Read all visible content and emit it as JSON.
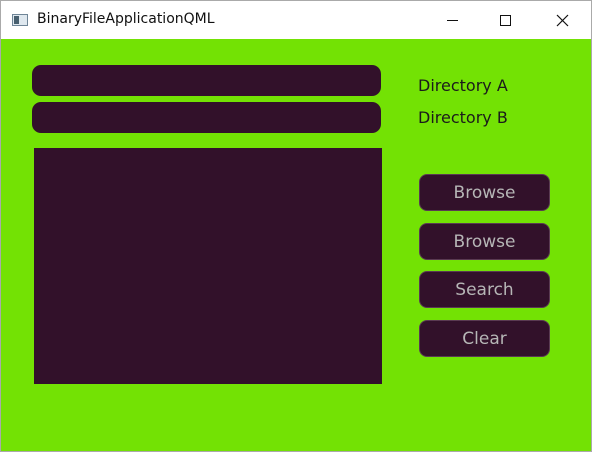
{
  "window": {
    "title": "BinaryFileApplicationQML",
    "icon": "app-window-icon",
    "controls": {
      "minimize_icon": "minimize-icon",
      "maximize_icon": "maximize-icon",
      "close_icon": "close-icon"
    }
  },
  "main": {
    "background": "#73e204",
    "panel_color": "#32112a",
    "directory_a": {
      "label": "Directory A",
      "value": ""
    },
    "directory_b": {
      "label": "Directory B",
      "value": ""
    },
    "results": "",
    "buttons": [
      {
        "label": "Browse"
      },
      {
        "label": "Browse"
      },
      {
        "label": "Search"
      },
      {
        "label": "Clear"
      }
    ]
  }
}
